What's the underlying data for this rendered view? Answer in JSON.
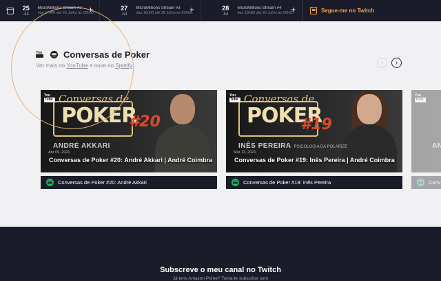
{
  "schedule": {
    "events": [
      {
        "day": "25",
        "month": "Jul",
        "title": "MicroMillions Stream #2",
        "subtitle": "das 17h00 até 26 Julho às 00h00."
      },
      {
        "day": "27",
        "month": "Jul",
        "title": "MicroMillions Stream #3",
        "subtitle": "das 16h00 até 28 Julho às 00h00."
      },
      {
        "day": "28",
        "month": "Jul",
        "title": "MicroMillions Stream #4",
        "subtitle": "das 18h00 até 29 Julho às 00h00."
      }
    ],
    "add_symbol": "+",
    "twitch_follow_label": "Segue-me no Twitch"
  },
  "section": {
    "title": "Conversas de Poker",
    "subtitle_prefix": "Ver mais no ",
    "youtube_link": "YouTube",
    "subtitle_middle": " e ouve no ",
    "spotify_link": "Spotify",
    "prev_symbol": "‹",
    "next_symbol": "›"
  },
  "cards": [
    {
      "thumb_youtube": [
        "You",
        "Tube"
      ],
      "logo_script": "Conversas de",
      "logo_main": "POKER",
      "episode": "#20",
      "guest": "ANDRÉ AKKARI",
      "guest_tag": "",
      "date": "Abr 09, 2021",
      "video_title": "Conversas de Poker #20: André Akkari | André Coimbra",
      "spotify_label": "Conversas de Poker #20: André Akkari"
    },
    {
      "thumb_youtube": [
        "You",
        "Tube"
      ],
      "logo_script": "Conversas de",
      "logo_main": "POKER",
      "episode": "#19",
      "guest": "INÊS PEREIRA",
      "guest_tag": "PSICOLOGIA DA POLARIZE",
      "date": "Mar 13, 2021",
      "video_title": "Conversas de Poker #19: Inês Pereira | André Coimbra",
      "spotify_label": "Conversas de Poker #19: Inês Pereira"
    },
    {
      "thumb_youtube": [
        "You",
        "Tube"
      ],
      "guest": "ANI",
      "spotify_label": "Conv"
    }
  ],
  "footer": {
    "title": "Subscreve o meu canal no Twitch",
    "subtitle": "Já tens Amazon Prime? Torna-te subscritor sem"
  },
  "colors": {
    "nav_bg": "#1b1c2a",
    "accent_orange": "#f1a44b",
    "spotify_green": "#1db954",
    "episode_red": "#d94a2f"
  }
}
